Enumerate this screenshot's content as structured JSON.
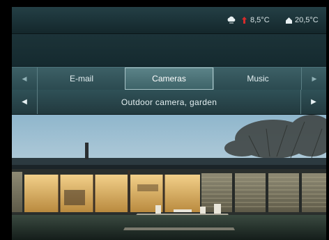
{
  "status": {
    "outdoor_temp": "8,5°C",
    "indoor_temp": "20,5°C",
    "icons": [
      "cloud-icon",
      "thermometer-up-icon",
      "house-icon"
    ]
  },
  "tabs": {
    "items": [
      {
        "label": "E-mail",
        "active": false
      },
      {
        "label": "Cameras",
        "active": true
      },
      {
        "label": "Music",
        "active": false
      }
    ]
  },
  "subnav": {
    "title": "Outdoor camera, garden"
  },
  "colors": {
    "background": "#0b1a1e",
    "tab_active": "#5b8388",
    "accent_red": "#d62b2b",
    "text": "#e3eef0"
  }
}
